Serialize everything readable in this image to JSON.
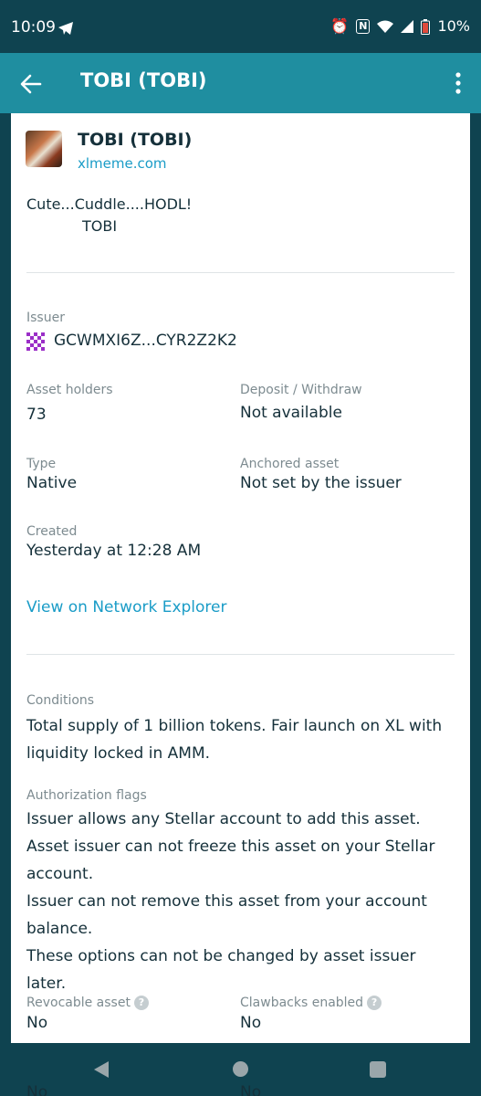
{
  "status_bar": {
    "time": "10:09",
    "battery": "10%",
    "icons": [
      "telegram-icon",
      "alarm-icon",
      "nfc-icon",
      "wifi-icon",
      "signal-icon",
      "battery-icon"
    ]
  },
  "app_bar": {
    "title": "TOBI (TOBI)"
  },
  "asset": {
    "title": "TOBI (TOBI)",
    "domain": "xlmeme.com",
    "description": "Cute...Cuddle....HODL!\n            TOBI"
  },
  "details": {
    "issuer_label": "Issuer",
    "issuer_value": "GCWMXI6Z...CYR2Z2K2",
    "holders_label": "Asset holders",
    "holders_value": "73",
    "deposit_label": "Deposit / Withdraw",
    "deposit_value": "Not available",
    "type_label": "Type",
    "type_value": "Native",
    "anchored_label": "Anchored asset",
    "anchored_value": "Not set by the issuer",
    "created_label": "Created",
    "created_value": "Yesterday at 12:28 AM",
    "explorer_link": "View on Network Explorer"
  },
  "conditions": {
    "label": "Conditions",
    "text": "Total supply of 1 billion tokens. Fair launch on XL with liquidity locked in AMM."
  },
  "auth_flags": {
    "label": "Authorization flags",
    "lines": [
      "Issuer allows any Stellar account to add this asset.",
      "Asset issuer can not freeze this asset on your Stellar account.",
      "Issuer can not remove this asset from your account balance.",
      "These options can not be changed by asset issuer later."
    ]
  },
  "flags": {
    "revocable_label": "Revocable asset",
    "revocable_value": "No",
    "clawback_label": "Clawbacks enabled",
    "clawback_value": "No",
    "peek_left": "No",
    "peek_right": "No"
  },
  "colors": {
    "status_bar": "#0f4350",
    "app_bar": "#1f8ea0",
    "link": "#1a9cc7",
    "text": "#15303a",
    "label": "#7d8b90"
  }
}
